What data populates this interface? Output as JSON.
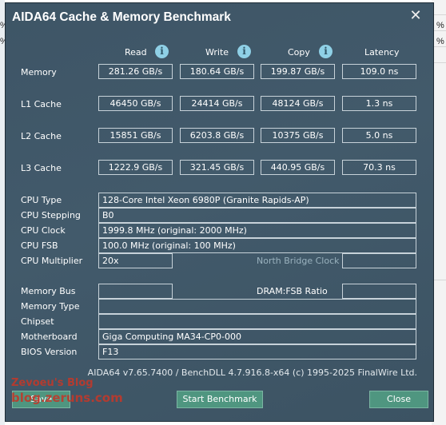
{
  "window": {
    "title": "AIDA64 Cache & Memory Benchmark"
  },
  "columns": {
    "read": "Read",
    "write": "Write",
    "copy": "Copy",
    "latency": "Latency"
  },
  "rows": {
    "memory": {
      "label": "Memory",
      "read": "281.26 GB/s",
      "write": "180.64 GB/s",
      "copy": "199.87 GB/s",
      "latency": "109.0 ns"
    },
    "l1": {
      "label": "L1 Cache",
      "read": "46450 GB/s",
      "write": "24414 GB/s",
      "copy": "48124 GB/s",
      "latency": "1.3 ns"
    },
    "l2": {
      "label": "L2 Cache",
      "read": "15851 GB/s",
      "write": "6203.8 GB/s",
      "copy": "10375 GB/s",
      "latency": "5.0 ns"
    },
    "l3": {
      "label": "L3 Cache",
      "read": "1222.9 GB/s",
      "write": "321.45 GB/s",
      "copy": "440.95 GB/s",
      "latency": "70.3 ns"
    }
  },
  "cpu": {
    "type_label": "CPU Type",
    "type_value": "128-Core Intel Xeon 6980P  (Granite Rapids-AP)",
    "stepping_label": "CPU Stepping",
    "stepping_value": "B0",
    "clock_label": "CPU Clock",
    "clock_value": "1999.8 MHz  (original: 2000 MHz)",
    "fsb_label": "CPU FSB",
    "fsb_value": "100.0 MHz  (original: 100 MHz)",
    "multiplier_label": "CPU Multiplier",
    "multiplier_value": "20x",
    "northbridge_label": "North Bridge Clock"
  },
  "memory_info": {
    "bus_label": "Memory Bus",
    "bus_value": "",
    "dram_ratio_label": "DRAM:FSB Ratio",
    "dram_ratio_value": "",
    "type_label": "Memory Type",
    "type_value": "",
    "chipset_label": "Chipset",
    "chipset_value": "",
    "motherboard_label": "Motherboard",
    "motherboard_value": "Giga Computing MA34-CP0-000",
    "bios_label": "BIOS Version",
    "bios_value": "F13"
  },
  "footer": {
    "version": "AIDA64 v7.65.7400 / BenchDLL 4.7.916.8-x64  (c) 1995-2025 FinalWire Ltd."
  },
  "buttons": {
    "save": "Save",
    "start": "Start Benchmark",
    "close": "Close"
  },
  "watermark": {
    "line1": "Zevoeu's Blog",
    "line2": "blog.zeruns.com"
  },
  "background": {
    "cell_text": "%"
  },
  "colors": {
    "window_bg": "#425a6b",
    "button_bg": "#4f9680",
    "info_icon": "#8fd0e6"
  }
}
